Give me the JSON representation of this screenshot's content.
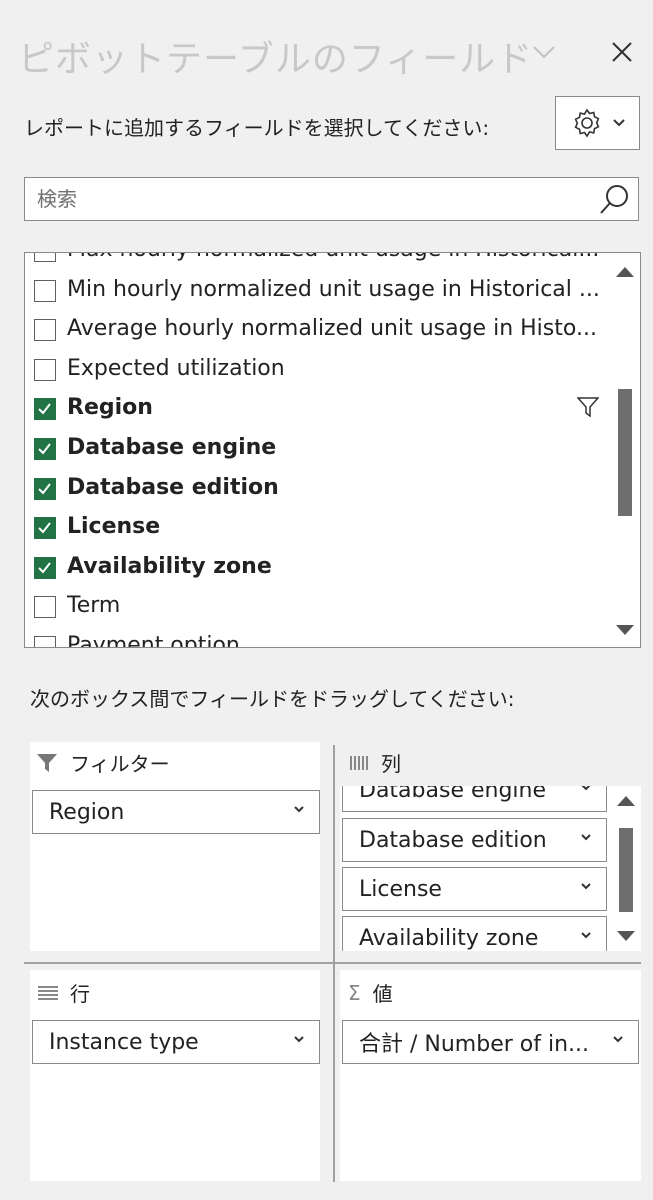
{
  "pane": {
    "title": "ピボットテーブルのフィールド",
    "subtitle": "レポートに追加するフィールドを選択してください:",
    "search_placeholder": "検索",
    "drag_caption": "次のボックス間でフィールドをドラッグしてください:"
  },
  "fields": [
    {
      "label": "Max hourly normalized unit usage in Historical...",
      "checked": false,
      "bold": false,
      "filter": false
    },
    {
      "label": "Min hourly normalized unit usage in Historical ...",
      "checked": false,
      "bold": false,
      "filter": false
    },
    {
      "label": "Average hourly normalized unit usage in Histo...",
      "checked": false,
      "bold": false,
      "filter": false
    },
    {
      "label": "Expected utilization",
      "checked": false,
      "bold": false,
      "filter": false
    },
    {
      "label": "Region",
      "checked": true,
      "bold": true,
      "filter": true
    },
    {
      "label": "Database engine",
      "checked": true,
      "bold": true,
      "filter": false
    },
    {
      "label": "Database edition",
      "checked": true,
      "bold": true,
      "filter": false
    },
    {
      "label": "License",
      "checked": true,
      "bold": true,
      "filter": false
    },
    {
      "label": "Availability zone",
      "checked": true,
      "bold": true,
      "filter": false
    },
    {
      "label": "Term",
      "checked": false,
      "bold": false,
      "filter": false
    },
    {
      "label": "Payment option",
      "checked": false,
      "bold": false,
      "filter": false
    }
  ],
  "areas": {
    "filters": {
      "label": "フィルター",
      "icon": "funnel-icon",
      "items": [
        "Region"
      ]
    },
    "columns": {
      "label": "列",
      "icon": "columns-icon",
      "items": [
        "Database engine",
        "Database edition",
        "License",
        "Availability zone"
      ]
    },
    "rows": {
      "label": "行",
      "icon": "rows-icon",
      "items": [
        "Instance type"
      ]
    },
    "values": {
      "label": "値",
      "icon": "sigma-icon",
      "symbol": "Σ",
      "items": [
        "合計 / Number of in..."
      ]
    }
  },
  "colors": {
    "check_green": "#217346",
    "background": "#f0f0f0",
    "title_gray": "#c8c8c8"
  }
}
